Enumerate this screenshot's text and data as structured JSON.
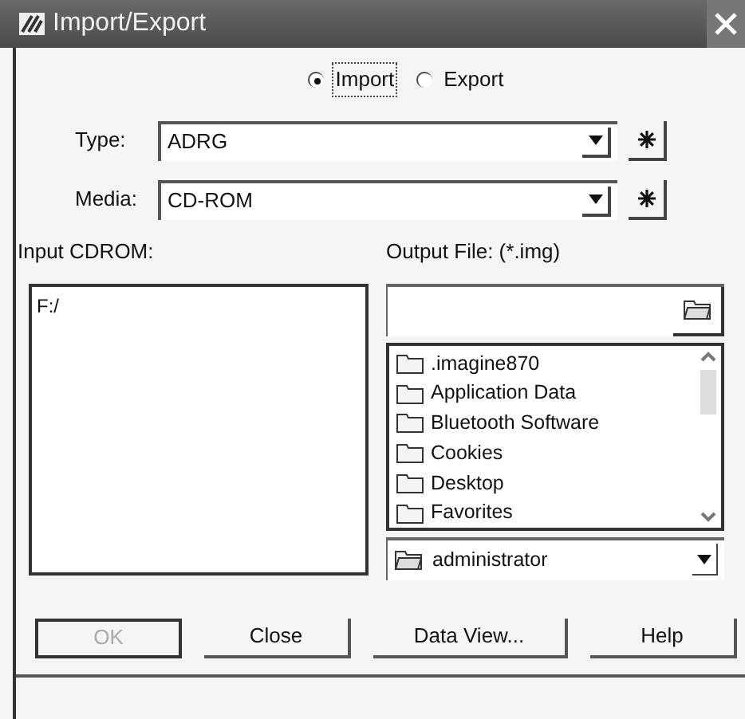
{
  "window": {
    "title": "Import/Export"
  },
  "mode": [
    {
      "label": "Import",
      "selected": true
    },
    {
      "label": "Export",
      "selected": false
    }
  ],
  "type": {
    "label": "Type:",
    "value": "ADRG"
  },
  "media": {
    "label": "Media:",
    "value": "CD-ROM"
  },
  "input": {
    "label": "Input CDROM:",
    "items": [
      "F:/"
    ]
  },
  "output": {
    "label": "Output File: (*.img)",
    "folders": [
      ".imagine870",
      "Application Data",
      "Bluetooth Software",
      "Cookies",
      "Desktop",
      "Favorites"
    ],
    "directory": "administrator"
  },
  "buttons": [
    {
      "label": "OK",
      "disabled": true
    },
    {
      "label": "Close",
      "disabled": false
    },
    {
      "label": "Data View...",
      "disabled": false
    },
    {
      "label": "Help",
      "disabled": false
    }
  ]
}
